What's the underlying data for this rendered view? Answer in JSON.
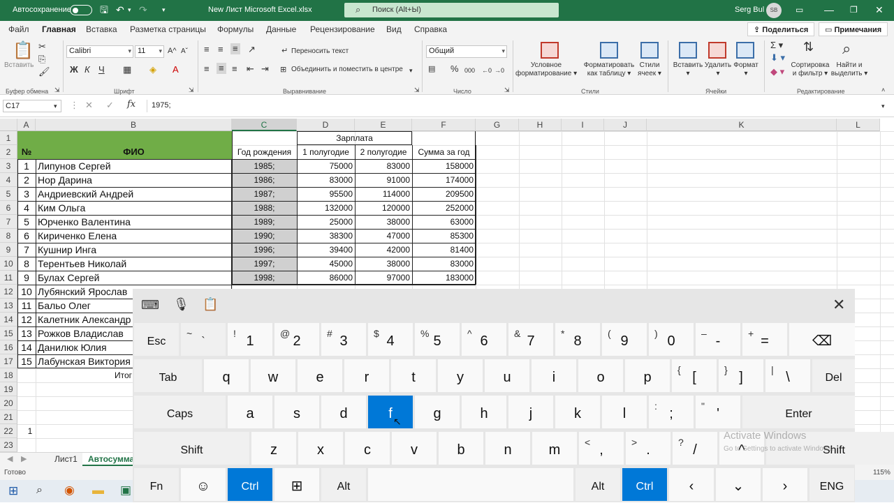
{
  "titlebar": {
    "autosave_label": "Автосохранение",
    "file_name": "New Лист Microsoft Excel.xlsx",
    "search_placeholder": "Поиск (Alt+Ы)",
    "user_name": "Serg Bul",
    "user_initials": "SB"
  },
  "menu": {
    "items": [
      "Файл",
      "Главная",
      "Вставка",
      "Разметка страницы",
      "Формулы",
      "Данные",
      "Рецензирование",
      "Вид",
      "Справка"
    ],
    "share_label": "Поделиться",
    "comments_label": "Примечания"
  },
  "ribbon": {
    "paste_label": "Вставить",
    "font_name": "Calibri",
    "font_size": "11",
    "wrap_text": "Переносить текст",
    "merge_center": "Объединить и поместить в центре",
    "number_format": "Общий",
    "cond_format": [
      "Условное",
      "форматирование ▾"
    ],
    "format_table": [
      "Форматировать",
      "как таблицу ▾"
    ],
    "cell_styles": [
      "Стили",
      "ячеек ▾"
    ],
    "insert_label": "Вставить",
    "delete_label": "Удалить",
    "format_label": "Формат",
    "sort_filter": [
      "Сортировка",
      "и фильтр ▾"
    ],
    "find_select": [
      "Найти и",
      "выделить ▾"
    ],
    "groups": [
      "Буфер обмена",
      "Шрифт",
      "Выравнивание",
      "Число",
      "Стили",
      "Ячейки",
      "Редактирование"
    ]
  },
  "formula_bar": {
    "name_box": "C17",
    "fx": "fx",
    "content": "1975;"
  },
  "grid": {
    "columns": [
      "A",
      "B",
      "C",
      "D",
      "E",
      "F",
      "G",
      "H",
      "I",
      "J",
      "K",
      "L"
    ],
    "rows": [
      "1",
      "2",
      "3",
      "4",
      "5",
      "6",
      "7",
      "8",
      "9",
      "10",
      "11",
      "12",
      "13",
      "14",
      "15",
      "16",
      "17",
      "18",
      "19",
      "20",
      "21",
      "22",
      "23"
    ],
    "header": {
      "num": "№",
      "fio": "ФИО",
      "year": "Год рождения",
      "salary": "Зарплата",
      "h1": "1 полугодие",
      "h2": "2 полугодие",
      "sum": "Сумма за год"
    },
    "data": [
      {
        "n": "1",
        "name": "Липунов Сергей",
        "year": "1985;",
        "h1": "75000",
        "h2": "83000",
        "sum": "158000"
      },
      {
        "n": "2",
        "name": "Нор Дарина",
        "year": "1986;",
        "h1": "83000",
        "h2": "91000",
        "sum": "174000"
      },
      {
        "n": "3",
        "name": "Андриевский Андрей",
        "year": "1987;",
        "h1": "95500",
        "h2": "114000",
        "sum": "209500"
      },
      {
        "n": "4",
        "name": "Ким Ольга",
        "year": "1988;",
        "h1": "132000",
        "h2": "120000",
        "sum": "252000"
      },
      {
        "n": "5",
        "name": "Юрченко Валентина",
        "year": "1989;",
        "h1": "25000",
        "h2": "38000",
        "sum": "63000"
      },
      {
        "n": "6",
        "name": "Кириченко Елена",
        "year": "1990;",
        "h1": "38300",
        "h2": "47000",
        "sum": "85300"
      },
      {
        "n": "7",
        "name": "Кушнир Инга",
        "year": "1996;",
        "h1": "39400",
        "h2": "42000",
        "sum": "81400"
      },
      {
        "n": "8",
        "name": "Терентьев Николай",
        "year": "1997;",
        "h1": "45000",
        "h2": "38000",
        "sum": "83000"
      },
      {
        "n": "9",
        "name": "Булах Сергей",
        "year": "1998;",
        "h1": "86000",
        "h2": "97000",
        "sum": "183000"
      },
      {
        "n": "10",
        "name": "Лубянский Ярослав",
        "year": "",
        "h1": "",
        "h2": "",
        "sum": ""
      },
      {
        "n": "11",
        "name": "Бальо Олег",
        "year": "",
        "h1": "",
        "h2": "",
        "sum": ""
      },
      {
        "n": "12",
        "name": "Калетник Александр",
        "year": "",
        "h1": "",
        "h2": "",
        "sum": ""
      },
      {
        "n": "13",
        "name": "Рожков Владислав",
        "year": "",
        "h1": "",
        "h2": "",
        "sum": ""
      },
      {
        "n": "14",
        "name": "Данилюк Юлия",
        "year": "",
        "h1": "",
        "h2": "",
        "sum": ""
      },
      {
        "n": "15",
        "name": "Лабунская Виктория",
        "year": "",
        "h1": "",
        "h2": "",
        "sum": ""
      }
    ],
    "total_label": "Итог",
    "a22": "1"
  },
  "sheets": {
    "tabs": [
      "Лист1",
      "Автосумма"
    ]
  },
  "status": {
    "ready": "Готово",
    "zoom": "115%"
  },
  "keyboard": {
    "row1": [
      {
        "m": "Esc"
      },
      {
        "m": "` ",
        "s": "~"
      },
      {
        "m": "1",
        "s": "!"
      },
      {
        "m": "2",
        "s": "@"
      },
      {
        "m": "3",
        "s": "#"
      },
      {
        "m": "4",
        "s": "$"
      },
      {
        "m": "5",
        "s": "%"
      },
      {
        "m": "6",
        "s": "^"
      },
      {
        "m": "7",
        "s": "&"
      },
      {
        "m": "8",
        "s": "*"
      },
      {
        "m": "9",
        "s": "("
      },
      {
        "m": "0",
        "s": ")"
      },
      {
        "m": "-",
        "s": "–"
      },
      {
        "m": "=",
        "s": "+"
      },
      {
        "m": "⌫"
      }
    ],
    "row2": [
      {
        "m": "Tab"
      },
      {
        "m": "q"
      },
      {
        "m": "w"
      },
      {
        "m": "e"
      },
      {
        "m": "r"
      },
      {
        "m": "t"
      },
      {
        "m": "y"
      },
      {
        "m": "u"
      },
      {
        "m": "i"
      },
      {
        "m": "o"
      },
      {
        "m": "p"
      },
      {
        "m": "[",
        "s": "{"
      },
      {
        "m": "]",
        "s": "}"
      },
      {
        "m": "\\",
        "s": "|"
      },
      {
        "m": "Del"
      }
    ],
    "row3": [
      {
        "m": "Caps"
      },
      {
        "m": "a"
      },
      {
        "m": "s"
      },
      {
        "m": "d"
      },
      {
        "m": "f"
      },
      {
        "m": "g"
      },
      {
        "m": "h"
      },
      {
        "m": "j"
      },
      {
        "m": "k"
      },
      {
        "m": "l"
      },
      {
        "m": ";",
        "s": ":"
      },
      {
        "m": "'",
        "s": "\""
      },
      {
        "m": "Enter"
      }
    ],
    "row4": [
      {
        "m": "Shift"
      },
      {
        "m": "z"
      },
      {
        "m": "x"
      },
      {
        "m": "c"
      },
      {
        "m": "v"
      },
      {
        "m": "b"
      },
      {
        "m": "n"
      },
      {
        "m": "m"
      },
      {
        "m": ",",
        "s": "<"
      },
      {
        "m": ".",
        "s": ">"
      },
      {
        "m": "/",
        "s": "?"
      },
      {
        "m": "^"
      },
      {
        "m": "Shift"
      }
    ],
    "row5": [
      {
        "m": "Fn"
      },
      {
        "m": "☺"
      },
      {
        "m": "Ctrl"
      },
      {
        "m": "⊞"
      },
      {
        "m": "Alt"
      },
      {
        "m": ""
      },
      {
        "m": "Alt"
      },
      {
        "m": "Ctrl"
      },
      {
        "m": "‹"
      },
      {
        "m": "⌄"
      },
      {
        "m": "›"
      },
      {
        "m": "ENG"
      }
    ],
    "watermark": "Activate Windows",
    "watermark_sub": "Go to Settings to activate Windows."
  },
  "colors": {
    "excel_green": "#217346",
    "header_green": "#70ad47",
    "selected_col": "#d0d0d0",
    "key_active": "#0078d7"
  }
}
